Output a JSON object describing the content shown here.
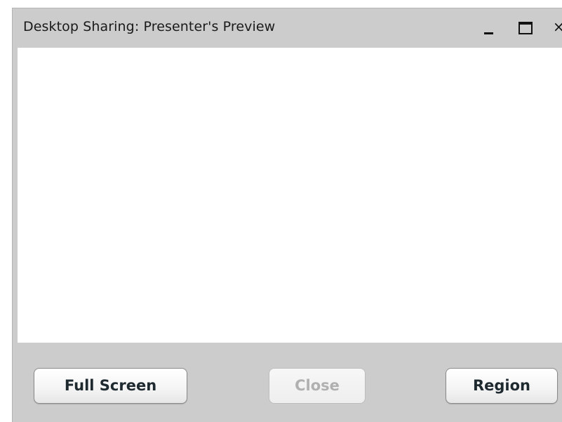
{
  "window": {
    "title": "Desktop Sharing: Presenter's Preview",
    "controls": {
      "minimize_icon": "minimize-icon",
      "maximize_icon": "maximize-icon",
      "close_icon": "close-icon",
      "close_glyph": "×"
    }
  },
  "buttons": {
    "full_screen": "Full Screen",
    "close": "Close",
    "region": "Region",
    "close_disabled": true
  },
  "colors": {
    "chrome": "#cccccc",
    "preview_background": "#ffffff",
    "disabled_text": "#b0b0b0"
  }
}
